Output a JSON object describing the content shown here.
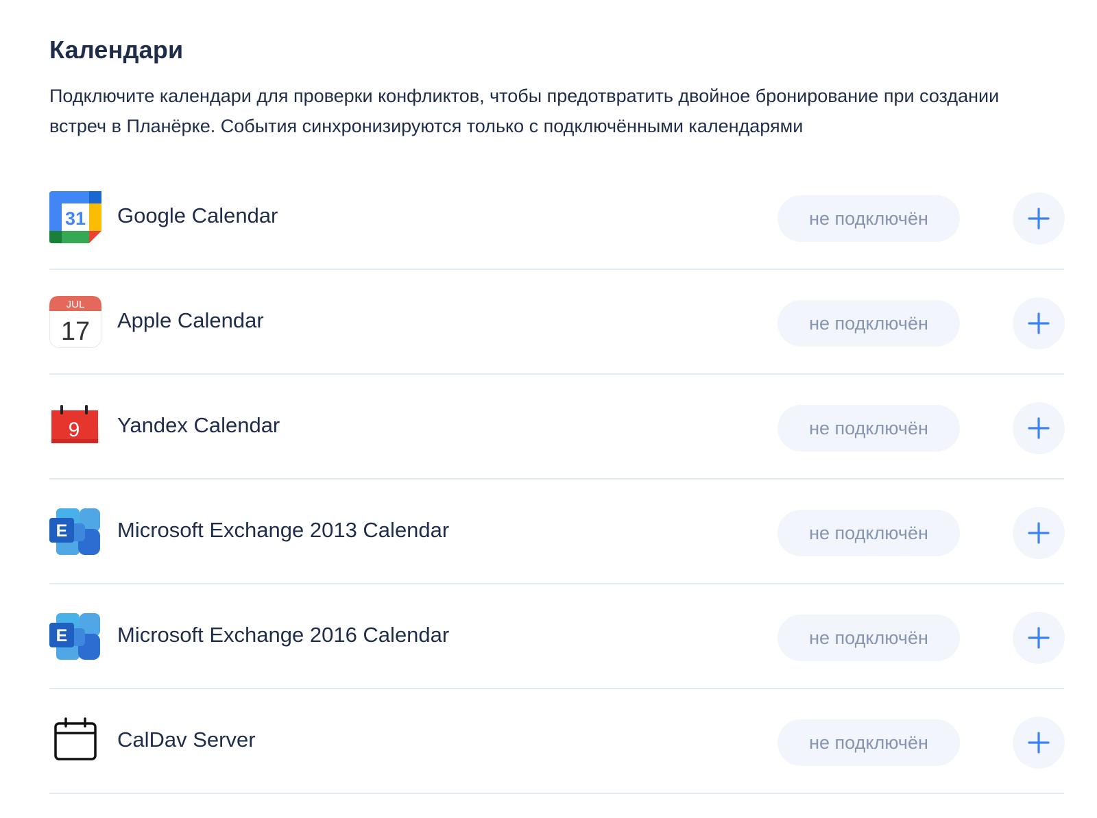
{
  "header": {
    "title": "Календари",
    "description": "Подключите календари для проверки конфликтов, чтобы предотвратить двойное бронирование при создании встреч в Планёрке. События синхронизируются только с подключёнными календарями"
  },
  "colors": {
    "text": "#1f2d4a",
    "badge_bg": "#f2f5fb",
    "badge_text": "#8794b2",
    "accent": "#3b82f6",
    "divider": "#e3ebf3"
  },
  "calendars": [
    {
      "name": "Google Calendar",
      "icon": "google-calendar-icon",
      "icon_text": "31",
      "status": "не подключён"
    },
    {
      "name": "Apple Calendar",
      "icon": "apple-calendar-icon",
      "icon_month": "JUL",
      "icon_day": "17",
      "status": "не подключён"
    },
    {
      "name": "Yandex Calendar",
      "icon": "yandex-calendar-icon",
      "icon_text": "9",
      "status": "не подключён"
    },
    {
      "name": "Microsoft Exchange 2013 Calendar",
      "icon": "exchange-icon",
      "icon_text": "E",
      "status": "не подключён"
    },
    {
      "name": "Microsoft Exchange 2016 Calendar",
      "icon": "exchange-icon",
      "icon_text": "E",
      "status": "не подключён"
    },
    {
      "name": "CalDav Server",
      "icon": "caldav-calendar-icon",
      "status": "не подключён"
    }
  ]
}
